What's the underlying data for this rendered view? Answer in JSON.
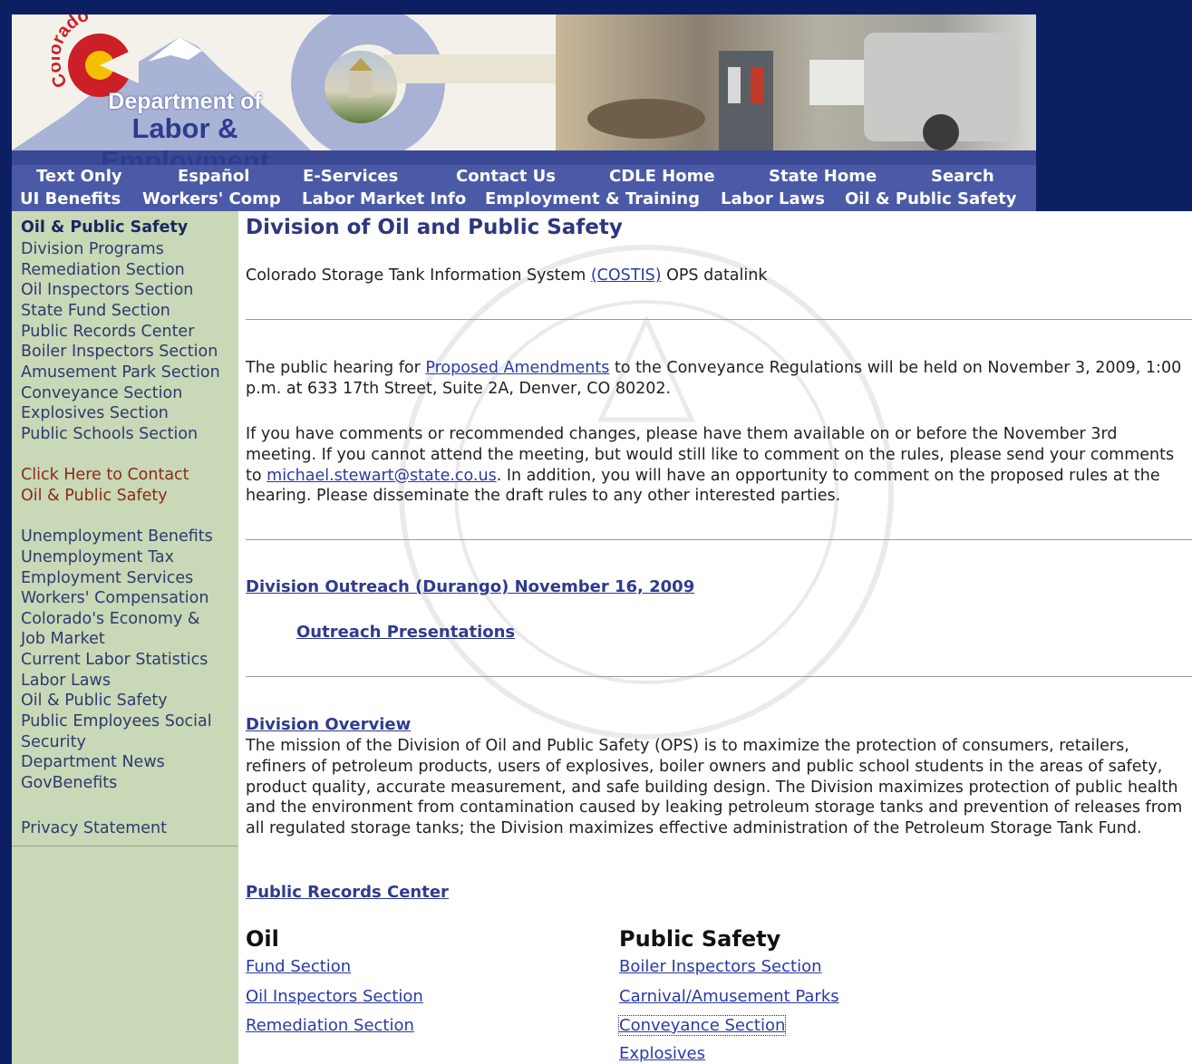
{
  "header": {
    "logo_arc": "Colorado",
    "logo_dept": "Department of",
    "logo_labor": "Labor & Employment"
  },
  "nav": {
    "row1": [
      "Text Only",
      "Español",
      "E-Services",
      "Contact Us",
      "CDLE Home",
      "State Home",
      "Search"
    ],
    "row2": [
      "UI Benefits",
      "Workers' Comp",
      "Labor Market Info",
      "Employment & Training",
      "Labor Laws",
      "Oil & Public Safety"
    ]
  },
  "sidebar": {
    "heading": "Oil & Public Safety",
    "division_links": [
      "Division Programs",
      "Remediation Section",
      "Oil Inspectors Section",
      "State Fund Section",
      "Public Records Center",
      "Boiler Inspectors Section",
      "Amusement Park Section",
      "Conveyance Section",
      "Explosives Section",
      "Public Schools Section"
    ],
    "contact_line1": "Click Here to Contact",
    "contact_line2": "Oil & Public Safety",
    "general_links": [
      "Unemployment Benefits",
      "Unemployment Tax",
      "Employment Services",
      "Workers' Compensation",
      "Colorado's Economy &",
      "Job Market",
      "Current Labor Statistics",
      "Labor Laws",
      "Oil & Public Safety",
      "Public Employees Social",
      "Security",
      "Department News",
      "GovBenefits"
    ],
    "privacy": "Privacy Statement"
  },
  "main": {
    "title": "Division of Oil and Public Safety",
    "costis_pre": "Colorado Storage Tank Information System ",
    "costis_link": "(COSTIS)",
    "costis_post": " OPS datalink",
    "hearing_pre": "The public hearing for ",
    "hearing_link": "Proposed Amendments",
    "hearing_post": " to the Conveyance Regulations will be held on November 3, 2009, 1:00 p.m. at 633 17th Street, Suite 2A, Denver, CO 80202.",
    "comments_pre": "If you have comments or recommended changes, please have them available on or before the November 3rd meeting. If you cannot attend the meeting, but would still like to comment on the rules, please send your comments to ",
    "comments_email": "michael.stewart@state.co.us",
    "comments_post": ". In addition, you will have an opportunity to comment on the proposed rules at the hearing. Please disseminate the draft rules to any other interested parties.",
    "outreach_link": "Division Outreach (Durango) November 16, 2009",
    "presentations_link": "Outreach Presentations",
    "overview_link": "Division Overview",
    "overview_text": "The mission of the Division of Oil and Public Safety (OPS) is to maximize the protection of consumers, retailers, refiners of petroleum products, users of explosives, boiler owners and public school students in the areas of safety, product quality, accurate measurement, and safe building design.  The Division maximizes protection of public health and the environment from contamination caused by leaking petroleum storage tanks and prevention of releases from all regulated storage tanks; the Division maximizes effective administration of the Petroleum Storage Tank Fund.",
    "records_link": "Public Records Center",
    "oil_title": "Oil",
    "oil_links": [
      "Fund Section",
      "Oil Inspectors Section",
      "Remediation Section"
    ],
    "safety_title": "Public Safety",
    "safety_links": [
      "Boiler Inspectors Section",
      "Carnival/Amusement Parks",
      "Conveyance Section",
      "Explosives"
    ]
  },
  "colors": {
    "page_bg": "#0d1f63",
    "nav_bg": "#4b5aa6",
    "sidebar_bg": "#c9d8b6",
    "link": "#2b3aa6",
    "title": "#2d3780"
  }
}
